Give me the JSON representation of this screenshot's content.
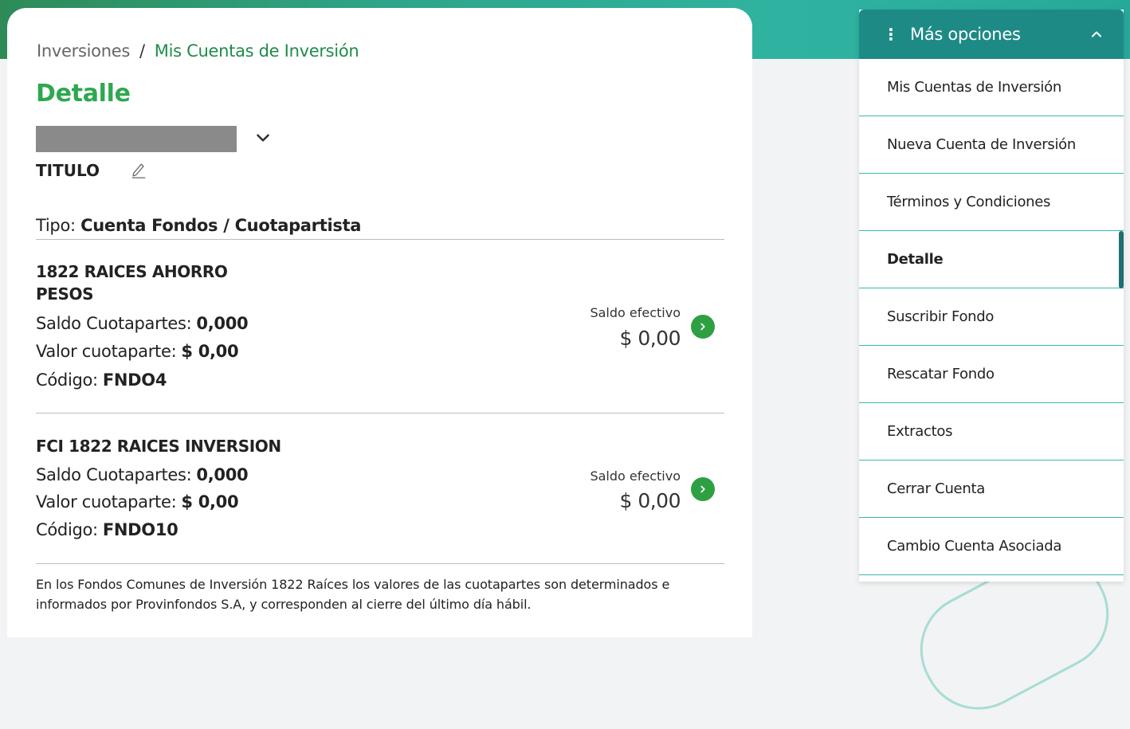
{
  "breadcrumb": {
    "root": "Inversiones",
    "separator": "/",
    "current": "Mis Cuentas de Inversión"
  },
  "page_title": "Detalle",
  "account": {
    "title": "TITULO"
  },
  "tipo": {
    "label": "Tipo:",
    "value": "Cuenta Fondos / Cuotapartista"
  },
  "funds": [
    {
      "name_line1": "1822 RAICES AHORRO",
      "name_line2": "PESOS",
      "saldo_cuotapartes_label": "Saldo Cuotapartes:",
      "saldo_cuotapartes": "0,000",
      "valor_label": "Valor cuotaparte:",
      "valor": "$ 0,00",
      "codigo_label": "Código:",
      "codigo": "FNDO4",
      "saldo_efectivo_label": "Saldo efectivo",
      "saldo_efectivo": "$ 0,00"
    },
    {
      "name_line1": "FCI 1822 RAICES INVERSION",
      "saldo_cuotapartes_label": "Saldo Cuotapartes:",
      "saldo_cuotapartes": "0,000",
      "valor_label": "Valor cuotaparte:",
      "valor": "$ 0,00",
      "codigo_label": "Código:",
      "codigo": "FNDO10",
      "saldo_efectivo_label": "Saldo efectivo",
      "saldo_efectivo": "$ 0,00"
    }
  ],
  "footnote_line1": "En los Fondos Comunes de Inversión 1822 Raíces los valores de las cuotapartes son determinados e",
  "footnote_line2": "informados por Provinfondos S.A, y corresponden al cierre del último día hábil.",
  "menu": {
    "header": "Más opciones",
    "items": [
      {
        "label": "Mis Cuentas de Inversión"
      },
      {
        "label": "Nueva Cuenta de Inversión"
      },
      {
        "label": "Términos y Condiciones"
      },
      {
        "label": "Detalle",
        "active": true
      },
      {
        "label": "Suscribir Fondo"
      },
      {
        "label": "Rescatar Fondo"
      },
      {
        "label": "Extractos"
      },
      {
        "label": "Cerrar Cuenta"
      },
      {
        "label": "Cambio Cuenta Asociada"
      }
    ]
  },
  "colors": {
    "brand_green": "#2da84f",
    "menu_header": "#1e8a86",
    "divider_teal": "#3bb8b0",
    "go_button": "#2ea043"
  },
  "icons": {
    "account_dropdown": "chevron-down-icon",
    "edit_title": "pencil-icon",
    "fund_detail": "chevron-right-icon",
    "menu_dots": "vertical-dots-icon",
    "menu_toggle": "chevron-up-icon"
  }
}
